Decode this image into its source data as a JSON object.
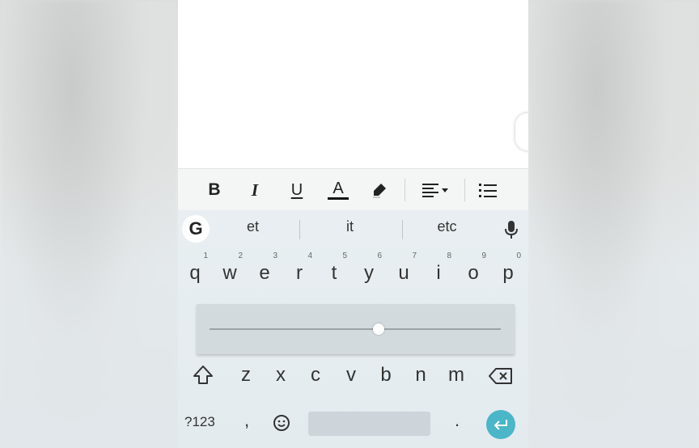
{
  "format_toolbar": {
    "bold": "B",
    "italic": "I",
    "underline": "U",
    "text_color": "A",
    "icons": [
      "bold-icon",
      "italic-icon",
      "underline-icon",
      "text-color-icon",
      "highlight-pen-icon",
      "align-left-dropdown-icon",
      "bulleted-list-icon"
    ]
  },
  "keyboard": {
    "google_button": "G",
    "suggestions": [
      "et",
      "it",
      "etc"
    ],
    "row1": [
      {
        "key": "q",
        "hint": "1"
      },
      {
        "key": "w",
        "hint": "2"
      },
      {
        "key": "e",
        "hint": "3"
      },
      {
        "key": "r",
        "hint": "4"
      },
      {
        "key": "t",
        "hint": "5"
      },
      {
        "key": "y",
        "hint": "6"
      },
      {
        "key": "u",
        "hint": "7"
      },
      {
        "key": "i",
        "hint": "8"
      },
      {
        "key": "o",
        "hint": "9"
      },
      {
        "key": "p",
        "hint": "0"
      }
    ],
    "row3": [
      "z",
      "x",
      "c",
      "v",
      "b",
      "n",
      "m"
    ],
    "bottom": {
      "symbols": "?123",
      "comma": ",",
      "period": "."
    },
    "cursor_slider_fraction": 0.58,
    "accent_color": "#4ab6c8"
  }
}
